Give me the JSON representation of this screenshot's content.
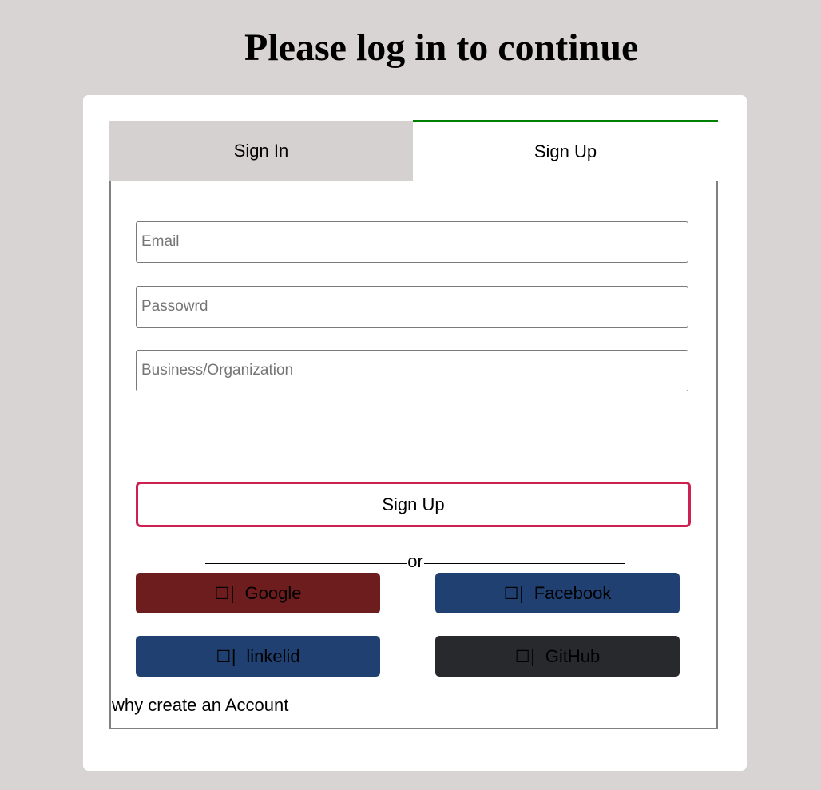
{
  "header": {
    "title": "Please log in to continue"
  },
  "tabs": [
    {
      "label": "Sign In",
      "active": false
    },
    {
      "label": "Sign Up",
      "active": true
    }
  ],
  "form": {
    "email_placeholder": "Email",
    "password_placeholder": "Passowrd",
    "org_placeholder": "Business/Organization",
    "submit_label": "Sign Up"
  },
  "divider": {
    "label": "or"
  },
  "social": {
    "icon_glyph": "☐|",
    "google": {
      "label": "Google",
      "color": "#6e1d1e"
    },
    "facebook": {
      "label": "Facebook",
      "color": "#1f4070"
    },
    "linkedin": {
      "label": "linkelid",
      "color": "#1f4070"
    },
    "github": {
      "label": "GitHub",
      "color": "#27292d"
    }
  },
  "footer": {
    "why_label": "why create an Account"
  },
  "colors": {
    "background": "#d8d4d3",
    "active_tab_accent": "#008000",
    "submit_border": "#cc2151"
  }
}
